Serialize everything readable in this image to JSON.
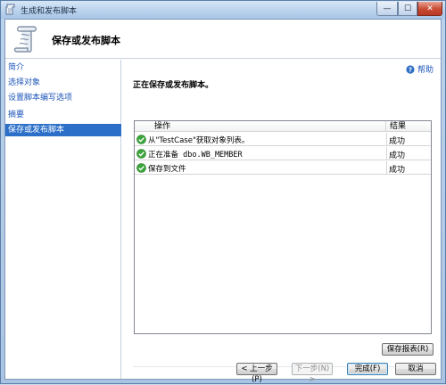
{
  "window": {
    "title": "生成和发布脚本",
    "controls": {
      "minimize": "—",
      "maximize": "☐",
      "close": "✕"
    }
  },
  "header": {
    "title": "保存或发布脚本"
  },
  "sidebar": {
    "items": [
      {
        "label": "简介",
        "active": false
      },
      {
        "label": "选择对象",
        "active": false
      },
      {
        "label": "设置脚本编写选项",
        "active": false
      },
      {
        "label": "摘要",
        "active": false
      },
      {
        "label": "保存或发布脚本",
        "active": true
      }
    ]
  },
  "main": {
    "help_label": "帮助",
    "status_heading": "正在保存或发布脚本。",
    "table": {
      "columns": [
        "操作",
        "结果"
      ],
      "rows": [
        {
          "icon": "success-check-icon",
          "action": "从\"TestCase\"获取对象列表。",
          "result": "成功"
        },
        {
          "icon": "success-check-icon",
          "action": "正在准备 dbo.WB_MEMBER",
          "result": "成功"
        },
        {
          "icon": "success-check-icon",
          "action": "保存到文件",
          "result": "成功"
        }
      ]
    },
    "save_report_label": "保存报表(R)"
  },
  "footer": {
    "back_label": "< 上一步(P)",
    "next_label": "下一步(N) >",
    "finish_label": "完成(F)",
    "cancel_label": "取消"
  },
  "colors": {
    "accent": "#2b6fc9",
    "link": "#1d56b8",
    "success": "#3aa53a"
  }
}
